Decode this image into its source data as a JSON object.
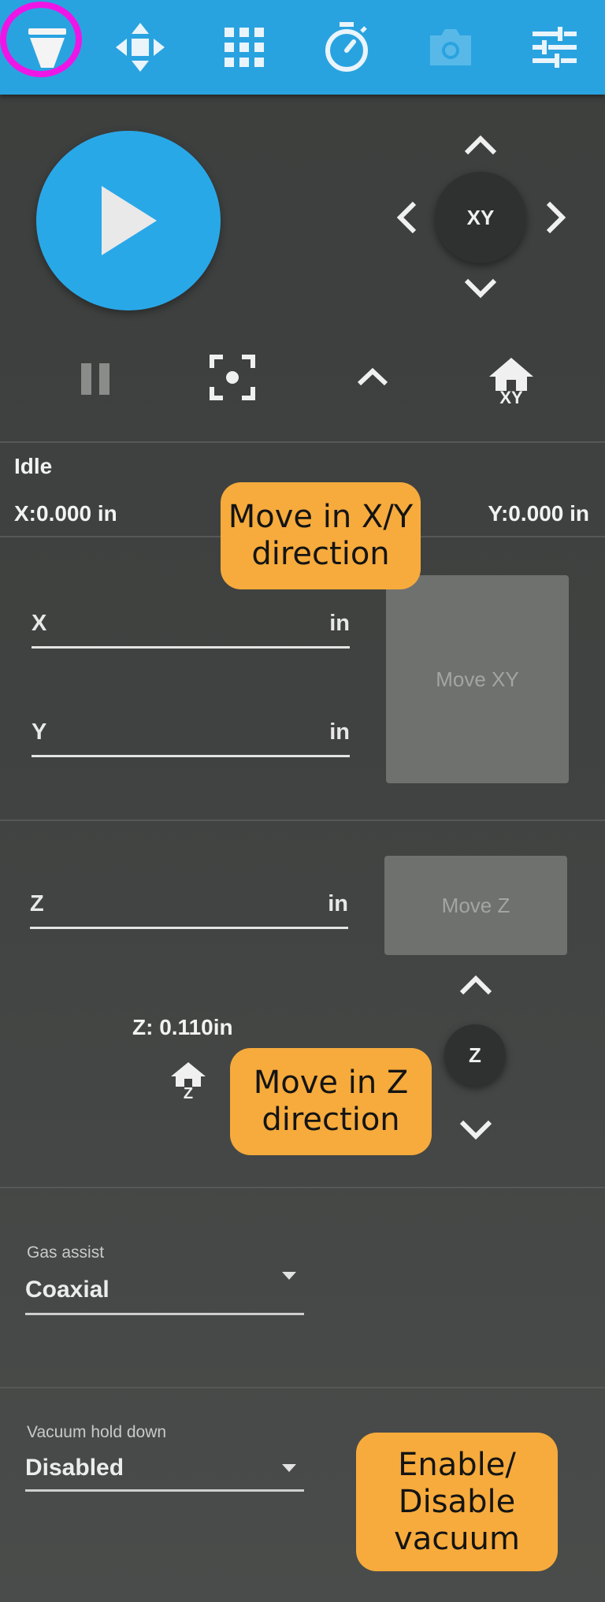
{
  "toolbar": {
    "tabs": [
      {
        "icon": "laser-head-icon"
      },
      {
        "icon": "move-arrows-icon"
      },
      {
        "icon": "grid-icon"
      },
      {
        "icon": "stopwatch-icon"
      },
      {
        "icon": "camera-icon"
      },
      {
        "icon": "settings-sliders-icon"
      }
    ],
    "accent": "#29a3e0",
    "highlight": "#ee16e6"
  },
  "jog_xy": {
    "center_label": "XY"
  },
  "controls": {
    "home_xy_label": "XY"
  },
  "status": {
    "state": "Idle",
    "x_position": "X:0.000 in",
    "y_position": "Y:0.000 in"
  },
  "move_xy": {
    "x_label": "X",
    "x_unit": "in",
    "y_label": "Y",
    "y_unit": "in",
    "button_label": "Move XY"
  },
  "move_z": {
    "z_label": "Z",
    "z_unit": "in",
    "button_label": "Move Z",
    "z_readout": "Z:  0.110in",
    "home_z_label": "Z",
    "jog_center_label": "Z"
  },
  "gas_assist": {
    "label": "Gas assist",
    "value": "Coaxial"
  },
  "vacuum": {
    "label": "Vacuum hold down",
    "value": "Disabled"
  },
  "callouts": {
    "xy_line1": "Move in X/Y",
    "xy_line2": "direction",
    "z_line1": "Move in Z",
    "z_line2": "direction",
    "vac_line1": "Enable/",
    "vac_line2": "Disable",
    "vac_line3": "vacuum",
    "color": "#f6ab3c"
  }
}
